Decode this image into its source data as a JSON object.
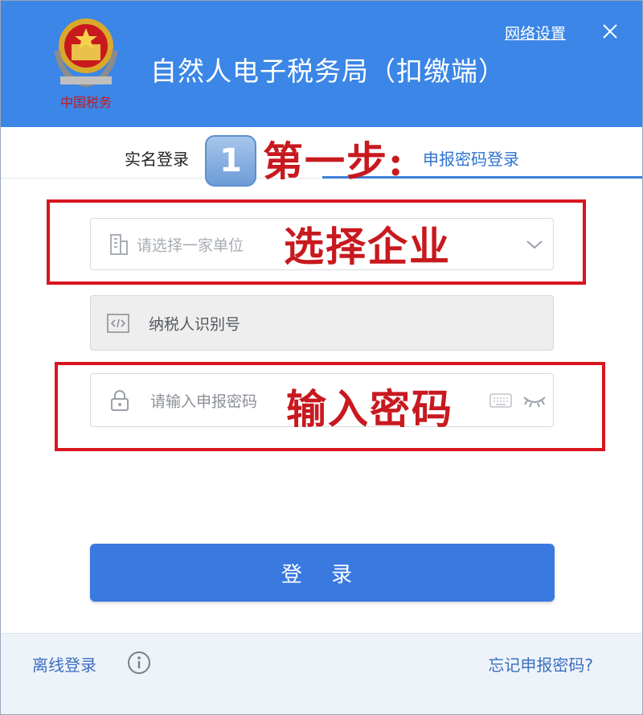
{
  "header": {
    "app_title": "自然人电子税务局（扣缴端）",
    "network_settings_label": "网络设置",
    "emblem_caption": "中国税务"
  },
  "tabs": [
    {
      "label": "实名登录",
      "active": false
    },
    {
      "label": "申报密码登录",
      "active": true
    }
  ],
  "annotations": {
    "step_badge": "1",
    "step_text": "第一步:",
    "select_company_text": "选择企业",
    "enter_password_text": "输入密码"
  },
  "form": {
    "company_placeholder": "请选择一家单位",
    "taxpayer_id_label": "纳税人识别号",
    "password_placeholder": "请输入申报密码"
  },
  "login_button_label": "登 录",
  "footer": {
    "offline_login_label": "离线登录",
    "forgot_password_label": "忘记申报密码?"
  },
  "colors": {
    "header_bg": "#3b86e6",
    "primary_button": "#3979e0",
    "active_tab": "#2f74d0",
    "annotation_red": "#d9151d"
  },
  "icons": [
    "building-icon",
    "chevron-down-icon",
    "code-icon",
    "lock-icon",
    "keyboard-icon",
    "eye-closed-icon",
    "info-icon",
    "close-icon",
    "emblem-icon"
  ]
}
